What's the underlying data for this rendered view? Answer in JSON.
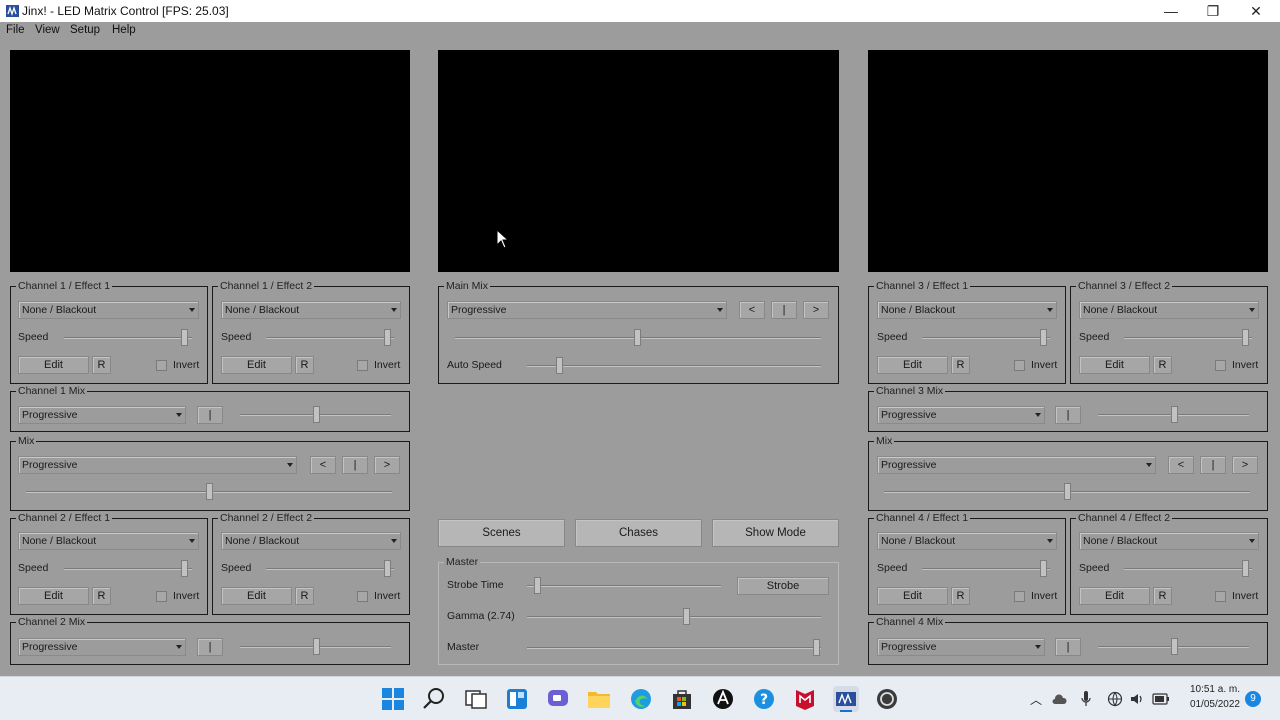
{
  "window": {
    "title": "Jinx! - LED Matrix Control [FPS: 25.03]",
    "minimize": "—",
    "maximize": "❐",
    "close": "✕"
  },
  "menu": [
    "File",
    "View",
    "Setup",
    "Help"
  ],
  "common": {
    "none_blackout": "None / Blackout",
    "progressive": "Progressive",
    "speed": "Speed",
    "edit": "Edit",
    "r": "R",
    "invert": "Invert",
    "bar": "|",
    "prev": "<",
    "next": ">"
  },
  "groups": {
    "ch1e1": "Channel 1 / Effect 1",
    "ch1e2": "Channel 1 / Effect 2",
    "ch1mix": "Channel 1 Mix",
    "mixL": "Mix",
    "ch2e1": "Channel 2 / Effect 1",
    "ch2e2": "Channel 2 / Effect 2",
    "ch2mix": "Channel 2 Mix",
    "mainmix": "Main Mix",
    "ch3e1": "Channel 3 / Effect 1",
    "ch3e2": "Channel 3 / Effect 2",
    "ch3mix": "Channel 3 Mix",
    "mixR": "Mix",
    "ch4e1": "Channel 4 / Effect 1",
    "ch4e2": "Channel 4 / Effect 2",
    "ch4mix": "Channel 4 Mix",
    "master": "Master"
  },
  "main_mix": {
    "auto_speed": "Auto Speed"
  },
  "center_buttons": {
    "scenes": "Scenes",
    "chases": "Chases",
    "show_mode": "Show Mode"
  },
  "master": {
    "strobe_time": "Strobe Time",
    "strobe": "Strobe",
    "gamma": "Gamma (2.74)",
    "master": "Master"
  },
  "taskbar": {
    "time": "10:51 a. m.",
    "date": "01/05/2022",
    "badge": "9"
  },
  "colors": {
    "red": "#c24a4a",
    "green": "#4fb04f",
    "blue": "#4a4ab8",
    "yellow": "#bdbd3c"
  }
}
